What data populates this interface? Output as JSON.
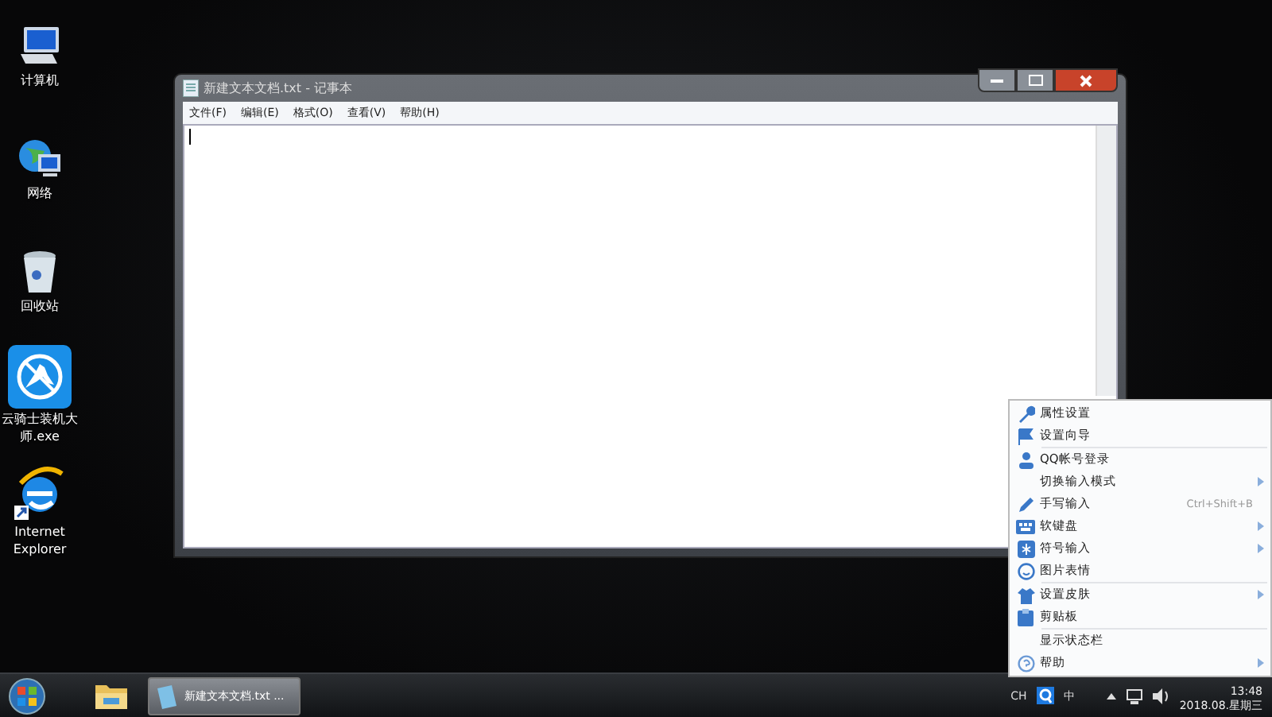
{
  "desktop_icons": [
    {
      "label": "计算机"
    },
    {
      "label": "网络"
    },
    {
      "label": "回收站"
    },
    {
      "label": "云骑士装机大师.exe"
    },
    {
      "label": "Internet Explorer"
    }
  ],
  "notepad": {
    "title": "新建文本文档.txt - 记事本",
    "menu": [
      "文件(F)",
      "编辑(E)",
      "格式(O)",
      "查看(V)",
      "帮助(H)"
    ]
  },
  "ime_menu": {
    "groups": [
      [
        {
          "label": "属性设置",
          "submenu": false
        },
        {
          "label": "设置向导",
          "submenu": false
        }
      ],
      [
        {
          "label": "QQ帐号登录",
          "submenu": false
        },
        {
          "label": "切换输入模式",
          "submenu": true
        },
        {
          "label": "手写输入",
          "submenu": false,
          "shortcut": "Ctrl+Shift+B"
        },
        {
          "label": "软键盘",
          "submenu": true
        },
        {
          "label": "符号输入",
          "submenu": true
        },
        {
          "label": "图片表情",
          "submenu": false
        }
      ],
      [
        {
          "label": "设置皮肤",
          "submenu": true
        },
        {
          "label": "剪贴板",
          "submenu": false
        }
      ],
      [
        {
          "label": "显示状态栏",
          "submenu": false
        },
        {
          "label": "帮助",
          "submenu": true
        }
      ]
    ]
  },
  "taskbar": {
    "tasks": [
      {
        "label": "新建文本文档.txt ...",
        "selected": true
      }
    ],
    "tray": {
      "language": "CH",
      "ime_mode": "中",
      "time": "13:48",
      "date": "2018.08.星期三"
    }
  }
}
